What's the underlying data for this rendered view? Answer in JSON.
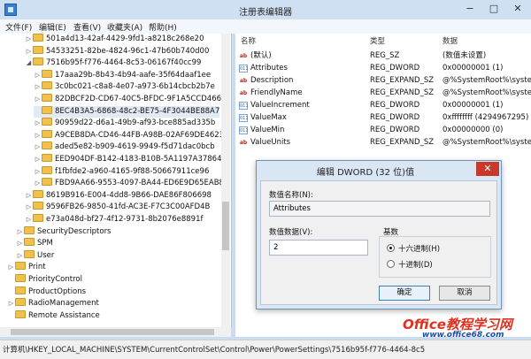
{
  "window": {
    "title": "注册表编辑器",
    "min": "−",
    "max": "□",
    "close": "✕"
  },
  "menu": [
    "文件(F)",
    "编辑(E)",
    "查看(V)",
    "收藏夹(A)",
    "帮助(H)"
  ],
  "tree": [
    {
      "label": "501a4d13-42af-4429-9fd1-a8218c268e20",
      "level": 3,
      "exp": "▷"
    },
    {
      "label": "54533251-82be-4824-96c1-47b60b740d00",
      "level": 3,
      "exp": "▷"
    },
    {
      "label": "7516b95f-f776-4464-8c53-06167f40cc99",
      "level": 3,
      "exp": "◢"
    },
    {
      "label": "17aaa29b-8b43-4b94-aafe-35f64daaf1ee",
      "level": 4,
      "exp": "▷"
    },
    {
      "label": "3c0bc021-c8a8-4e07-a973-6b14cbcb2b7e",
      "level": 4,
      "exp": "▷"
    },
    {
      "label": "82DBCF2D-CD67-40C5-BFDC-9F1A5CCD4663",
      "level": 4,
      "exp": "▷"
    },
    {
      "label": "8EC4B3A5-6868-48c2-BE75-4F3044BE88A7",
      "level": 4,
      "exp": "",
      "selected": true
    },
    {
      "label": "90959d22-d6a1-49b9-af93-bce885ad335b",
      "level": 4,
      "exp": "▷"
    },
    {
      "label": "A9CEB8DA-CD46-44FB-A98B-02AF69DE4623",
      "level": 4,
      "exp": "▷"
    },
    {
      "label": "aded5e82-b909-4619-9949-f5d71dac0bcb",
      "level": 4,
      "exp": "▷"
    },
    {
      "label": "EED904DF-B142-4183-B10B-5A1197A37864",
      "level": 4,
      "exp": "▷"
    },
    {
      "label": "f1fbfde2-a960-4165-9f88-50667911ce96",
      "level": 4,
      "exp": "▷"
    },
    {
      "label": "FBD9AA66-9553-4097-BA44-ED6E9D65EAB8",
      "level": 4,
      "exp": "▷"
    },
    {
      "label": "8619B916-E004-4dd8-9B66-DAE86F806698",
      "level": 3,
      "exp": "▷"
    },
    {
      "label": "9596FB26-9850-41fd-AC3E-F7C3C00AFD4B",
      "level": 3,
      "exp": "▷"
    },
    {
      "label": "e73a048d-bf27-4f12-9731-8b2076e8891f",
      "level": 3,
      "exp": "▷"
    },
    {
      "label": "SecurityDescriptors",
      "level": 2,
      "exp": "▷"
    },
    {
      "label": "SPM",
      "level": 2,
      "exp": "▷"
    },
    {
      "label": "User",
      "level": 2,
      "exp": "▷"
    },
    {
      "label": "Print",
      "level": 1,
      "exp": "▷"
    },
    {
      "label": "PriorityControl",
      "level": 1,
      "exp": ""
    },
    {
      "label": "ProductOptions",
      "level": 1,
      "exp": ""
    },
    {
      "label": "RadioManagement",
      "level": 1,
      "exp": "▷"
    },
    {
      "label": "Remote Assistance",
      "level": 1,
      "exp": ""
    }
  ],
  "list": {
    "headers": [
      "名称",
      "类型",
      "数据"
    ],
    "rows": [
      {
        "icon": "ab",
        "name": "(默认)",
        "type": "REG_SZ",
        "data": "(数值未设置)"
      },
      {
        "icon": "bin",
        "name": "Attributes",
        "type": "REG_DWORD",
        "data": "0x00000001 (1)"
      },
      {
        "icon": "ab",
        "name": "Description",
        "type": "REG_EXPAND_SZ",
        "data": "@%SystemRoot%\\syste"
      },
      {
        "icon": "ab",
        "name": "FriendlyName",
        "type": "REG_EXPAND_SZ",
        "data": "@%SystemRoot%\\syste"
      },
      {
        "icon": "bin",
        "name": "ValueIncrement",
        "type": "REG_DWORD",
        "data": "0x00000001 (1)"
      },
      {
        "icon": "bin",
        "name": "ValueMax",
        "type": "REG_DWORD",
        "data": "0xffffffff (4294967295)"
      },
      {
        "icon": "bin",
        "name": "ValueMin",
        "type": "REG_DWORD",
        "data": "0x00000000 (0)"
      },
      {
        "icon": "ab",
        "name": "ValueUnits",
        "type": "REG_EXPAND_SZ",
        "data": "@%SystemRoot%\\syste"
      }
    ]
  },
  "dialog": {
    "title": "编辑 DWORD (32 位)值",
    "close": "✕",
    "name_label": "数值名称(N):",
    "name_value": "Attributes",
    "data_label": "数值数据(V):",
    "data_value": "2",
    "base_label": "基数",
    "hex_label": "十六进制(H)",
    "dec_label": "十进制(D)",
    "ok": "确定",
    "cancel": "取消"
  },
  "status": "计算机\\HKEY_LOCAL_MACHINE\\SYSTEM\\CurrentControlSet\\Control\\Power\\PowerSettings\\7516b95f-f776-4464-8c5",
  "watermark": {
    "main": "Office教程学习网",
    "sub": "www.office68.com"
  }
}
